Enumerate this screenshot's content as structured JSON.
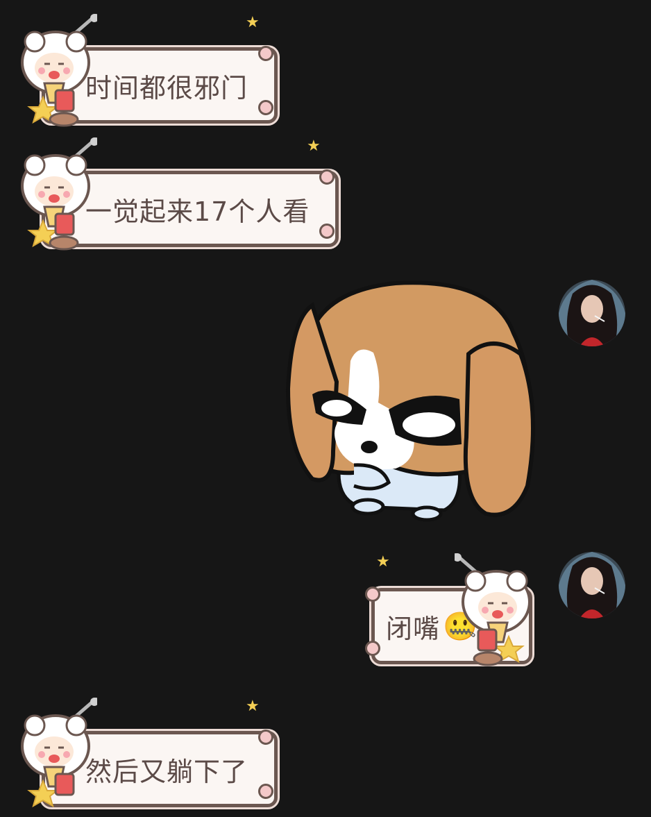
{
  "messages": [
    {
      "side": "left",
      "text": "时间都很邪门"
    },
    {
      "side": "left",
      "text": "一觉起来17个人看"
    },
    {
      "side": "right",
      "type": "sticker",
      "icon": "angry-puppy-sticker"
    },
    {
      "side": "right",
      "text": "闭嘴",
      "emoji": "🤐"
    },
    {
      "side": "left",
      "text": "然后又躺下了"
    }
  ],
  "colors": {
    "background": "#161616",
    "bubble_fill": "#fbf6f3",
    "bubble_border": "#6b5750",
    "text": "#5b4a47",
    "star": "#f4cf55"
  }
}
